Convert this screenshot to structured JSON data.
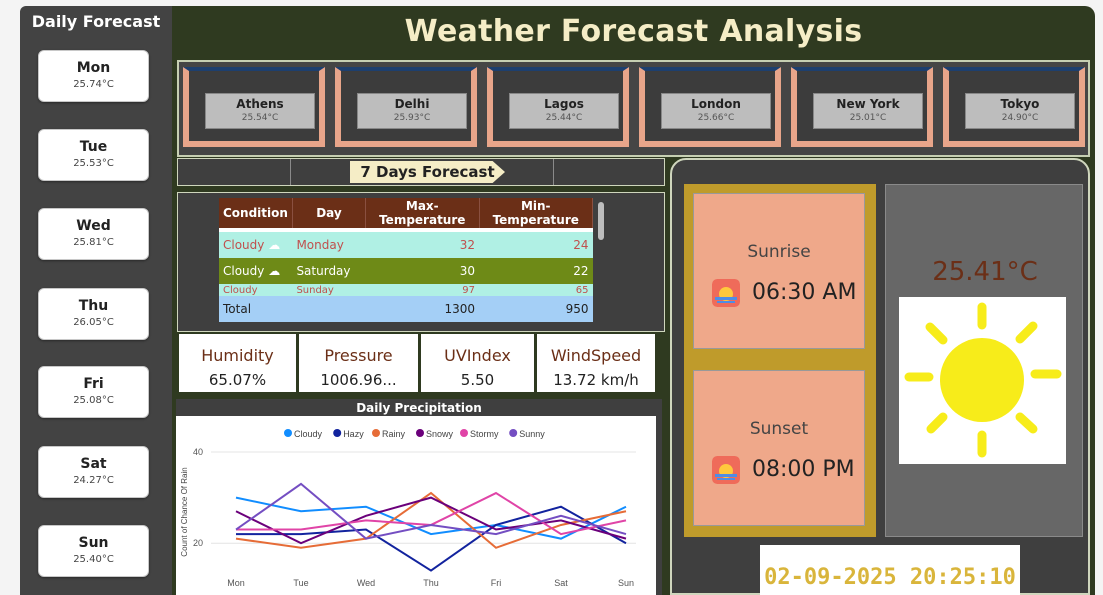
{
  "sidebar": {
    "title": "Daily Forecast",
    "days": [
      {
        "name": "Mon",
        "temp": "25.74°C"
      },
      {
        "name": "Tue",
        "temp": "25.53°C"
      },
      {
        "name": "Wed",
        "temp": "25.81°C"
      },
      {
        "name": "Thu",
        "temp": "26.05°C"
      },
      {
        "name": "Fri",
        "temp": "25.08°C"
      },
      {
        "name": "Sat",
        "temp": "24.27°C"
      },
      {
        "name": "Sun",
        "temp": "25.40°C"
      }
    ]
  },
  "header": {
    "title": "Weather Forecast Analysis"
  },
  "cities": [
    {
      "name": "Athens",
      "temp": "25.54°C"
    },
    {
      "name": "Delhi",
      "temp": "25.93°C"
    },
    {
      "name": "Lagos",
      "temp": "25.44°C"
    },
    {
      "name": "London",
      "temp": "25.66°C"
    },
    {
      "name": "New York",
      "temp": "25.01°C"
    },
    {
      "name": "Tokyo",
      "temp": "24.90°C"
    }
  ],
  "forecast": {
    "banner": "7 Days Forecast",
    "columns": [
      "Condition",
      "Day",
      "Max-Temperature",
      "Min-Temperature"
    ],
    "rows": [
      {
        "condition": "Cloudy",
        "day": "Monday",
        "max": "32",
        "min": "24"
      },
      {
        "condition": "Cloudy",
        "day": "Saturday",
        "max": "30",
        "min": "22"
      },
      {
        "condition": "Cloudy",
        "day": "Sunday",
        "max": "97",
        "min": "65"
      }
    ],
    "total": {
      "label": "Total",
      "max": "1300",
      "min": "950"
    }
  },
  "metrics": [
    {
      "label": "Humidity",
      "value": "65.07%"
    },
    {
      "label": "Pressure",
      "value": "1006.96..."
    },
    {
      "label": "UVIndex",
      "value": "5.50"
    },
    {
      "label": "WindSpeed",
      "value": "13.72 km/h"
    }
  ],
  "sun": {
    "sunrise_label": "Sunrise",
    "sunrise_time": "06:30 AM",
    "sunset_label": "Sunset",
    "sunset_time": "08:00 PM"
  },
  "current": {
    "temp": "25.41°C",
    "condition_icon": "sun-icon"
  },
  "datetime": "02-09-2025 20:25:10",
  "colors": {
    "accent": "#6b2f17",
    "table_header": "#6b2f17",
    "datetime": "#d9b53b"
  },
  "chart_data": {
    "type": "line",
    "title": "Daily Precipitation",
    "xlabel": "",
    "ylabel": "Count of Chance Of Rain",
    "categories": [
      "Mon",
      "Tue",
      "Wed",
      "Thu",
      "Fri",
      "Sat",
      "Sun"
    ],
    "yticks": [
      20,
      40
    ],
    "ylim": [
      15,
      40
    ],
    "legend_position": "top",
    "series": [
      {
        "name": "Cloudy",
        "color": "#118dff",
        "values": [
          30,
          27,
          28,
          22,
          24,
          21,
          28
        ]
      },
      {
        "name": "Hazy",
        "color": "#12239e",
        "values": [
          22,
          22,
          23,
          14,
          24,
          28,
          20
        ]
      },
      {
        "name": "Rainy",
        "color": "#e66c37",
        "values": [
          21,
          19,
          21,
          31,
          19,
          24,
          27
        ]
      },
      {
        "name": "Snowy",
        "color": "#6b007b",
        "values": [
          27,
          20,
          26,
          30,
          23,
          25,
          21
        ]
      },
      {
        "name": "Stormy",
        "color": "#e044a7",
        "values": [
          23,
          23,
          25,
          24,
          31,
          22,
          25
        ]
      },
      {
        "name": "Sunny",
        "color": "#744ec2",
        "values": [
          23,
          33,
          21,
          24,
          22,
          26,
          22
        ]
      }
    ]
  }
}
